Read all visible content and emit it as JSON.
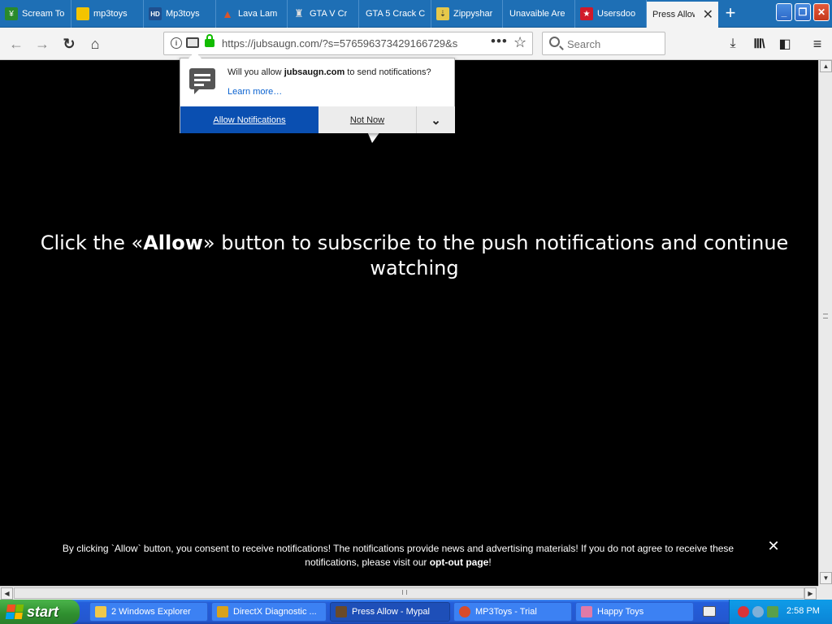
{
  "tabs": [
    {
      "label": "Scream To",
      "icon": "scream-favicon",
      "color": "#2a8a2a"
    },
    {
      "label": "mp3toys",
      "icon": "mp3toys-favicon",
      "color": "#f3c400"
    },
    {
      "label": "Mp3toys",
      "icon": "hd-favicon",
      "color": "#1f4f8f"
    },
    {
      "label": "Lava Lam",
      "icon": "lava-lamp-favicon",
      "color": "#d9542b"
    },
    {
      "label": "GTA V Cr",
      "icon": "gta-favicon",
      "color": "#444444"
    },
    {
      "label": "GTA 5 Crack C",
      "icon": "blank-favicon",
      "color": "#1e6fb5"
    },
    {
      "label": "Zippyshar",
      "icon": "zippyshare-favicon",
      "color": "#e6c84a"
    },
    {
      "label": "Unavaible Are",
      "icon": "blank-favicon",
      "color": "#1e6fb5"
    },
    {
      "label": "Usersdoo",
      "icon": "usersdoo-favicon",
      "color": "#d11a2a"
    },
    {
      "label": "Press Allow",
      "icon": "blank-favicon",
      "color": "#f3f3f3"
    }
  ],
  "window_controls": {
    "minimize": "_",
    "restore": "❐",
    "close": "✕"
  },
  "toolbar": {
    "url": "https://jubsaugn.com/?s=576596373429166729&s",
    "more": "•••",
    "search_placeholder": "Search"
  },
  "popup": {
    "question_prefix": "Will you allow ",
    "domain": "jubsaugn.com",
    "question_suffix": " to send notifications?",
    "learn_more": "Learn more…",
    "allow_label": "Allow Notifications",
    "not_now_label": "Not Now",
    "dropdown": "⌄"
  },
  "page": {
    "headline_prefix": "Click the «",
    "headline_bold": "Allow",
    "headline_suffix": "» button to subscribe to the push notifications and continue watching",
    "consent_text": "By clicking `Allow` button, you consent to receive notifications! The notifications provide news and advertising materials! If you do not agree to receive these notifications, please visit our ",
    "consent_link": "opt-out page",
    "consent_end": "!",
    "close_label": "✕"
  },
  "taskbar": {
    "start_label": "start",
    "items": [
      {
        "label": "2 Windows Explorer",
        "icon": "folder-icon",
        "color": "#f0c84a"
      },
      {
        "label": "DirectX Diagnostic ...",
        "icon": "directx-icon",
        "color": "#d9a21b"
      },
      {
        "label": "Press Allow - Mypal",
        "icon": "mypal-icon",
        "color": "#6a4a2a"
      },
      {
        "label": "MP3Toys - Trial",
        "icon": "mp3toys-app-icon",
        "color": "#d84b2b"
      },
      {
        "label": "Happy Toys",
        "icon": "happy-toys-icon",
        "color": "#e07aa8"
      }
    ],
    "clock": "2:58 PM"
  }
}
